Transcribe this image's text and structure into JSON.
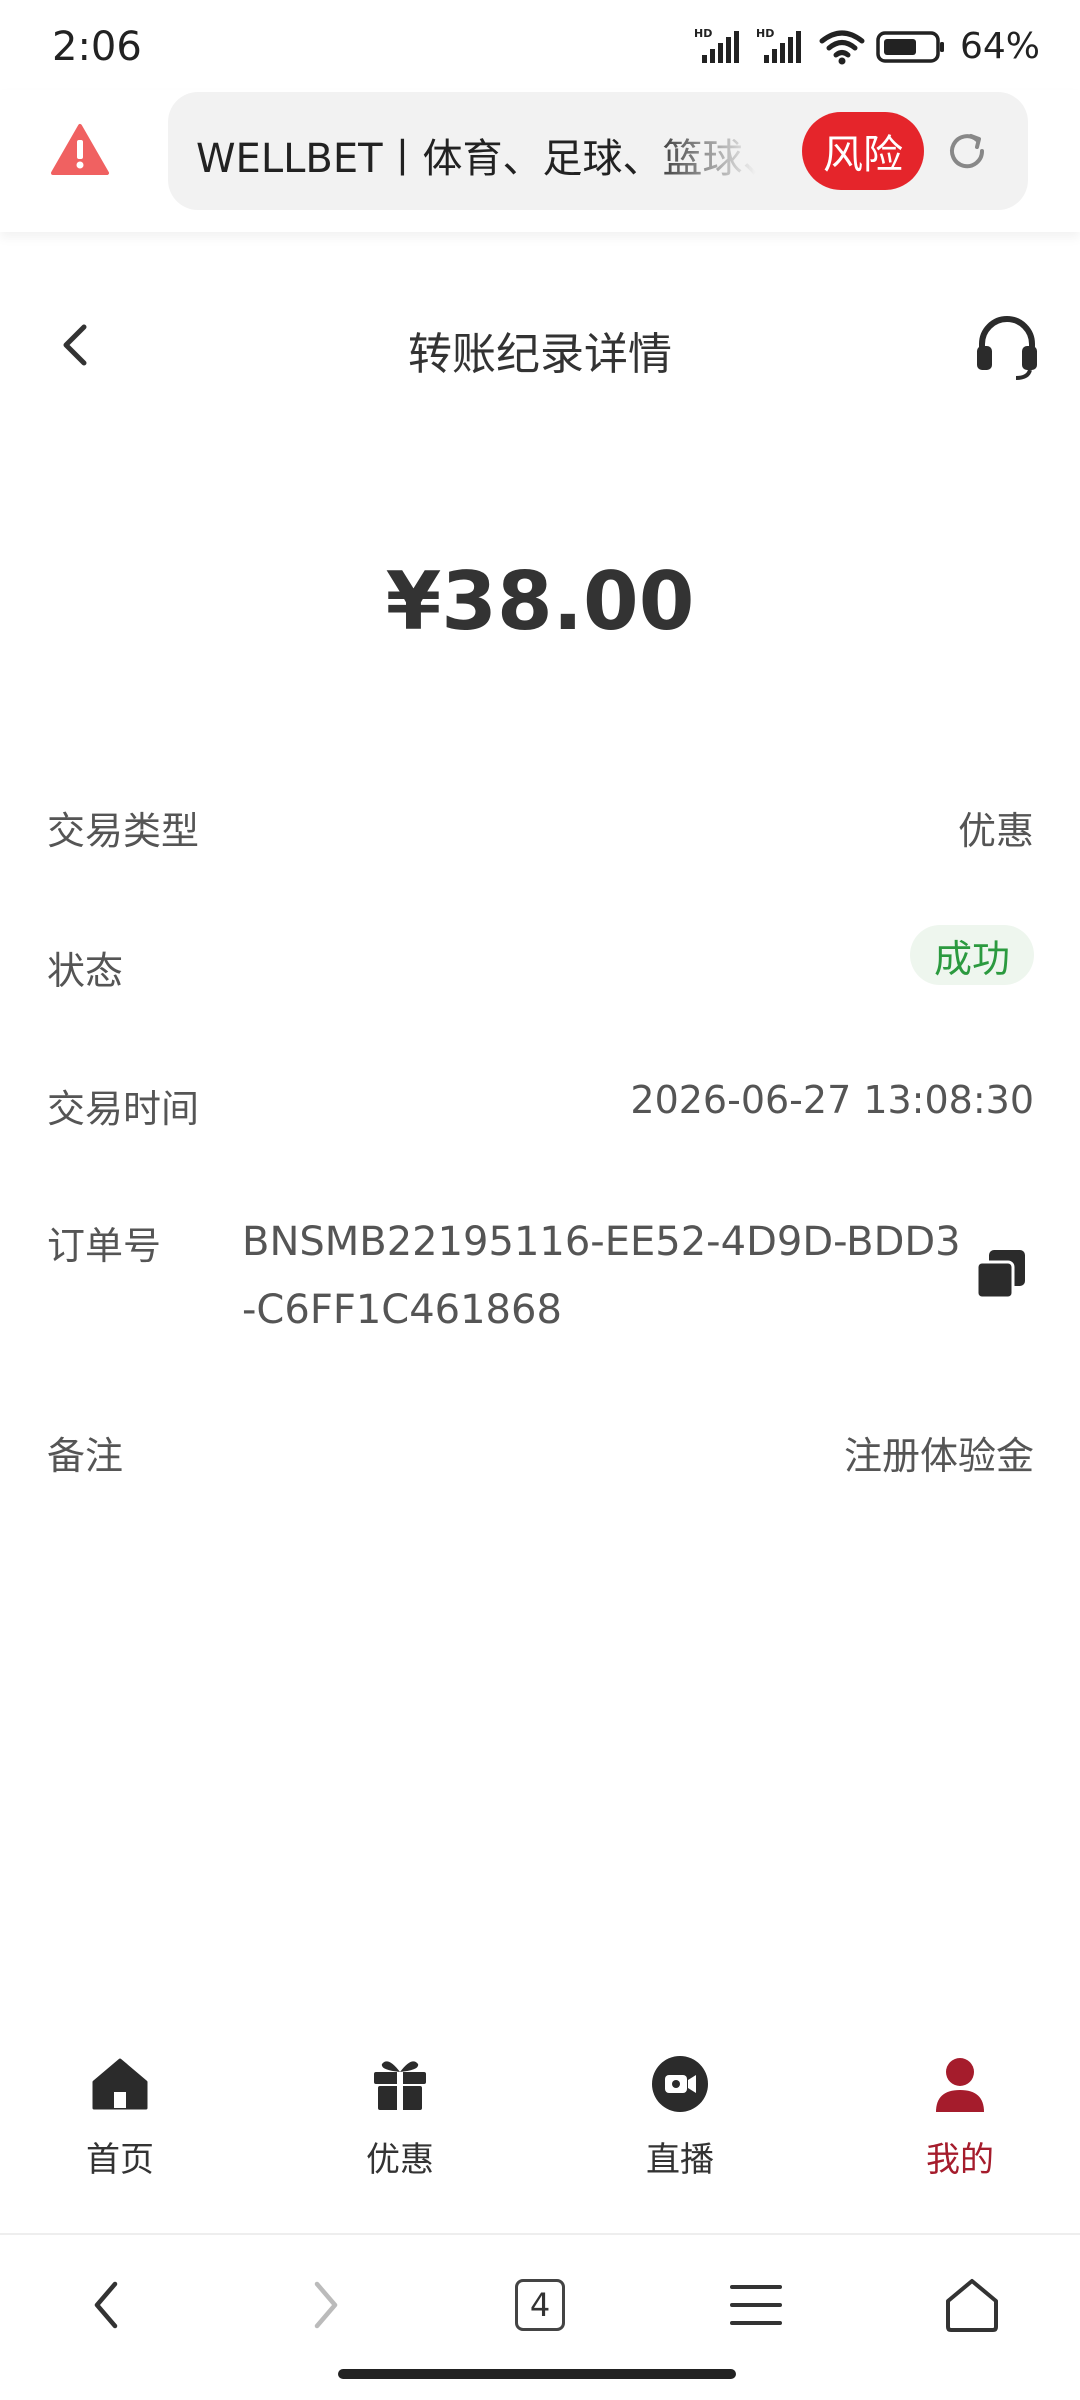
{
  "status_bar": {
    "time": "2:06",
    "network_1": "HD",
    "network_2": "HD",
    "battery": "64%"
  },
  "browser": {
    "url_title": "WELLBET丨体育、足球、篮球、",
    "risk_label": "风险",
    "risk_color": "#e5252b"
  },
  "header": {
    "title": "转账纪录详情"
  },
  "amount": "¥38.00",
  "details": {
    "type_label": "交易类型",
    "type_value": "优惠",
    "status_label": "状态",
    "status_value": "成功",
    "time_label": "交易时间",
    "time_value": "2026-06-27 13:08:30",
    "order_label": "订单号",
    "order_value": "BNSMB22195116-EE52-4D9D-BDD3-C6FF1C461868",
    "note_label": "备注",
    "note_value": "注册体验金"
  },
  "tabs": [
    {
      "label": "首页",
      "icon": "home-icon"
    },
    {
      "label": "优惠",
      "icon": "gift-icon"
    },
    {
      "label": "直播",
      "icon": "video-icon"
    },
    {
      "label": "我的",
      "icon": "user-icon"
    }
  ],
  "active_tab": "我的",
  "accent_color": "#a51c2c",
  "browser_nav": {
    "tab_count": "4"
  }
}
